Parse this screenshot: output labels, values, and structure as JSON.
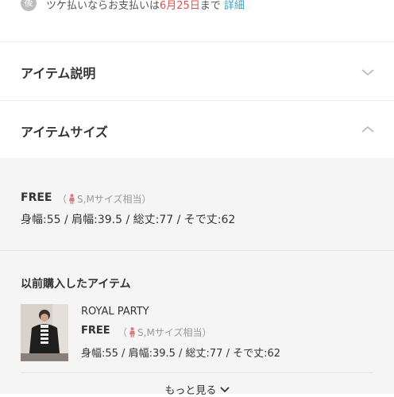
{
  "notice": {
    "icon_char": "後",
    "text_before": "ツケ払いならお支払いは",
    "date": "6月25日",
    "text_after": "まで",
    "link": "詳細",
    "date_color": "#d9534f",
    "link_color": "#3aa0c6"
  },
  "accordion": {
    "description_title": "アイテム説明",
    "description_icon": "chevron-down-icon",
    "size_title": "アイテムサイズ",
    "size_icon": "chevron-up-icon"
  },
  "size_info": {
    "name": "FREE",
    "note_open": "（",
    "note": "S,Mサイズ相当）",
    "measurements": "身幅:55 / 肩幅:39.5 / 総丈:77 / そで丈:62"
  },
  "previous_purchase": {
    "title": "以前購入したアイテム",
    "brand": "ROYAL PARTY",
    "size": "FREE",
    "note_open": "（",
    "note": "S,Mサイズ相当）",
    "measurements": "身幅:55 / 肩幅:39.5 / 総丈:77 / そで丈:62",
    "more_label": "もっと見る"
  }
}
